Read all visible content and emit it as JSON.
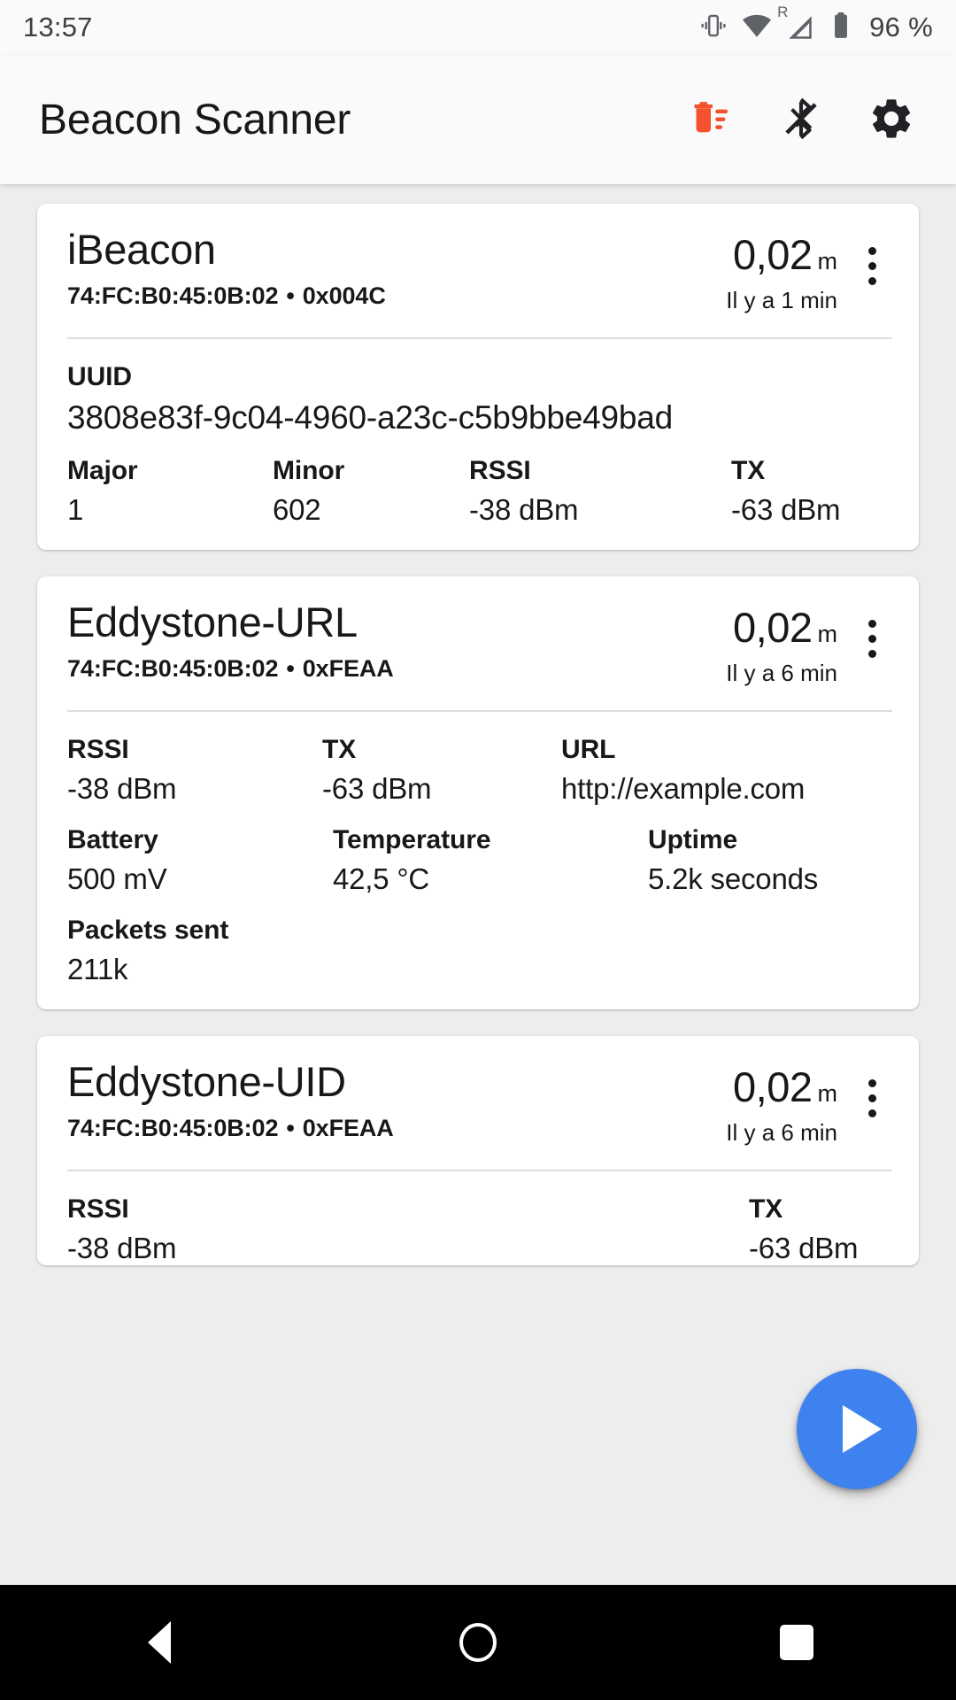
{
  "status_bar": {
    "clock": "13:57",
    "battery_percent": "96 %",
    "roaming_label": "R",
    "icons": [
      "vibrate-icon",
      "wifi-icon",
      "cellular-signal-icon",
      "battery-icon"
    ]
  },
  "app_bar": {
    "title": "Beacon Scanner",
    "actions": [
      {
        "name": "clear-list-button",
        "icon": "delete-sweep-icon",
        "color": "#f4512c"
      },
      {
        "name": "bluetooth-toggle-button",
        "icon": "bluetooth-disabled-icon",
        "color": "#1f2124"
      },
      {
        "name": "settings-button",
        "icon": "gear-icon",
        "color": "#1f2124"
      }
    ]
  },
  "beacons": [
    {
      "type": "iBeacon",
      "address": "74:FC:B0:45:0B:02",
      "separator": "•",
      "company_id": "0x004C",
      "distance": "0,02",
      "distance_unit": "m",
      "last_seen": "Il y a 1 min",
      "rows": [
        [
          {
            "label": "UUID",
            "value": "3808e83f-9c04-4960-a23c-c5b9bbe49bad",
            "span": "full"
          }
        ],
        [
          {
            "label": "Major",
            "value": "1"
          },
          {
            "label": "Minor",
            "value": "602"
          },
          {
            "label": "RSSI",
            "value": "-38 dBm"
          },
          {
            "label": "TX",
            "value": "-63 dBm"
          }
        ]
      ]
    },
    {
      "type": "Eddystone-URL",
      "address": "74:FC:B0:45:0B:02",
      "separator": "•",
      "company_id": "0xFEAA",
      "distance": "0,02",
      "distance_unit": "m",
      "last_seen": "Il y a 6 min",
      "rows": [
        [
          {
            "label": "RSSI",
            "value": "-38 dBm"
          },
          {
            "label": "TX",
            "value": "-63 dBm"
          },
          {
            "label": "URL",
            "value": "http://example.com"
          }
        ],
        [
          {
            "label": "Battery",
            "value": "500 mV"
          },
          {
            "label": "Temperature",
            "value": "42,5 °C"
          },
          {
            "label": "Uptime",
            "value": "5.2k seconds"
          }
        ],
        [
          {
            "label": "Packets sent",
            "value": "211k",
            "span": "full"
          }
        ]
      ]
    },
    {
      "type": "Eddystone-UID",
      "address": "74:FC:B0:45:0B:02",
      "separator": "•",
      "company_id": "0xFEAA",
      "distance": "0,02",
      "distance_unit": "m",
      "last_seen": "Il y a 6 min",
      "rows": [
        [
          {
            "label": "RSSI",
            "value": "-38 dBm"
          },
          {
            "label": "TX",
            "value": "-63 dBm"
          }
        ]
      ]
    }
  ],
  "fab": {
    "name": "start-scan-button",
    "icon": "play-icon",
    "color": "#3d82ee"
  },
  "nav_bar": {
    "back": "back-triangle-icon",
    "home": "home-circle-icon",
    "recents": "recents-square-icon"
  }
}
